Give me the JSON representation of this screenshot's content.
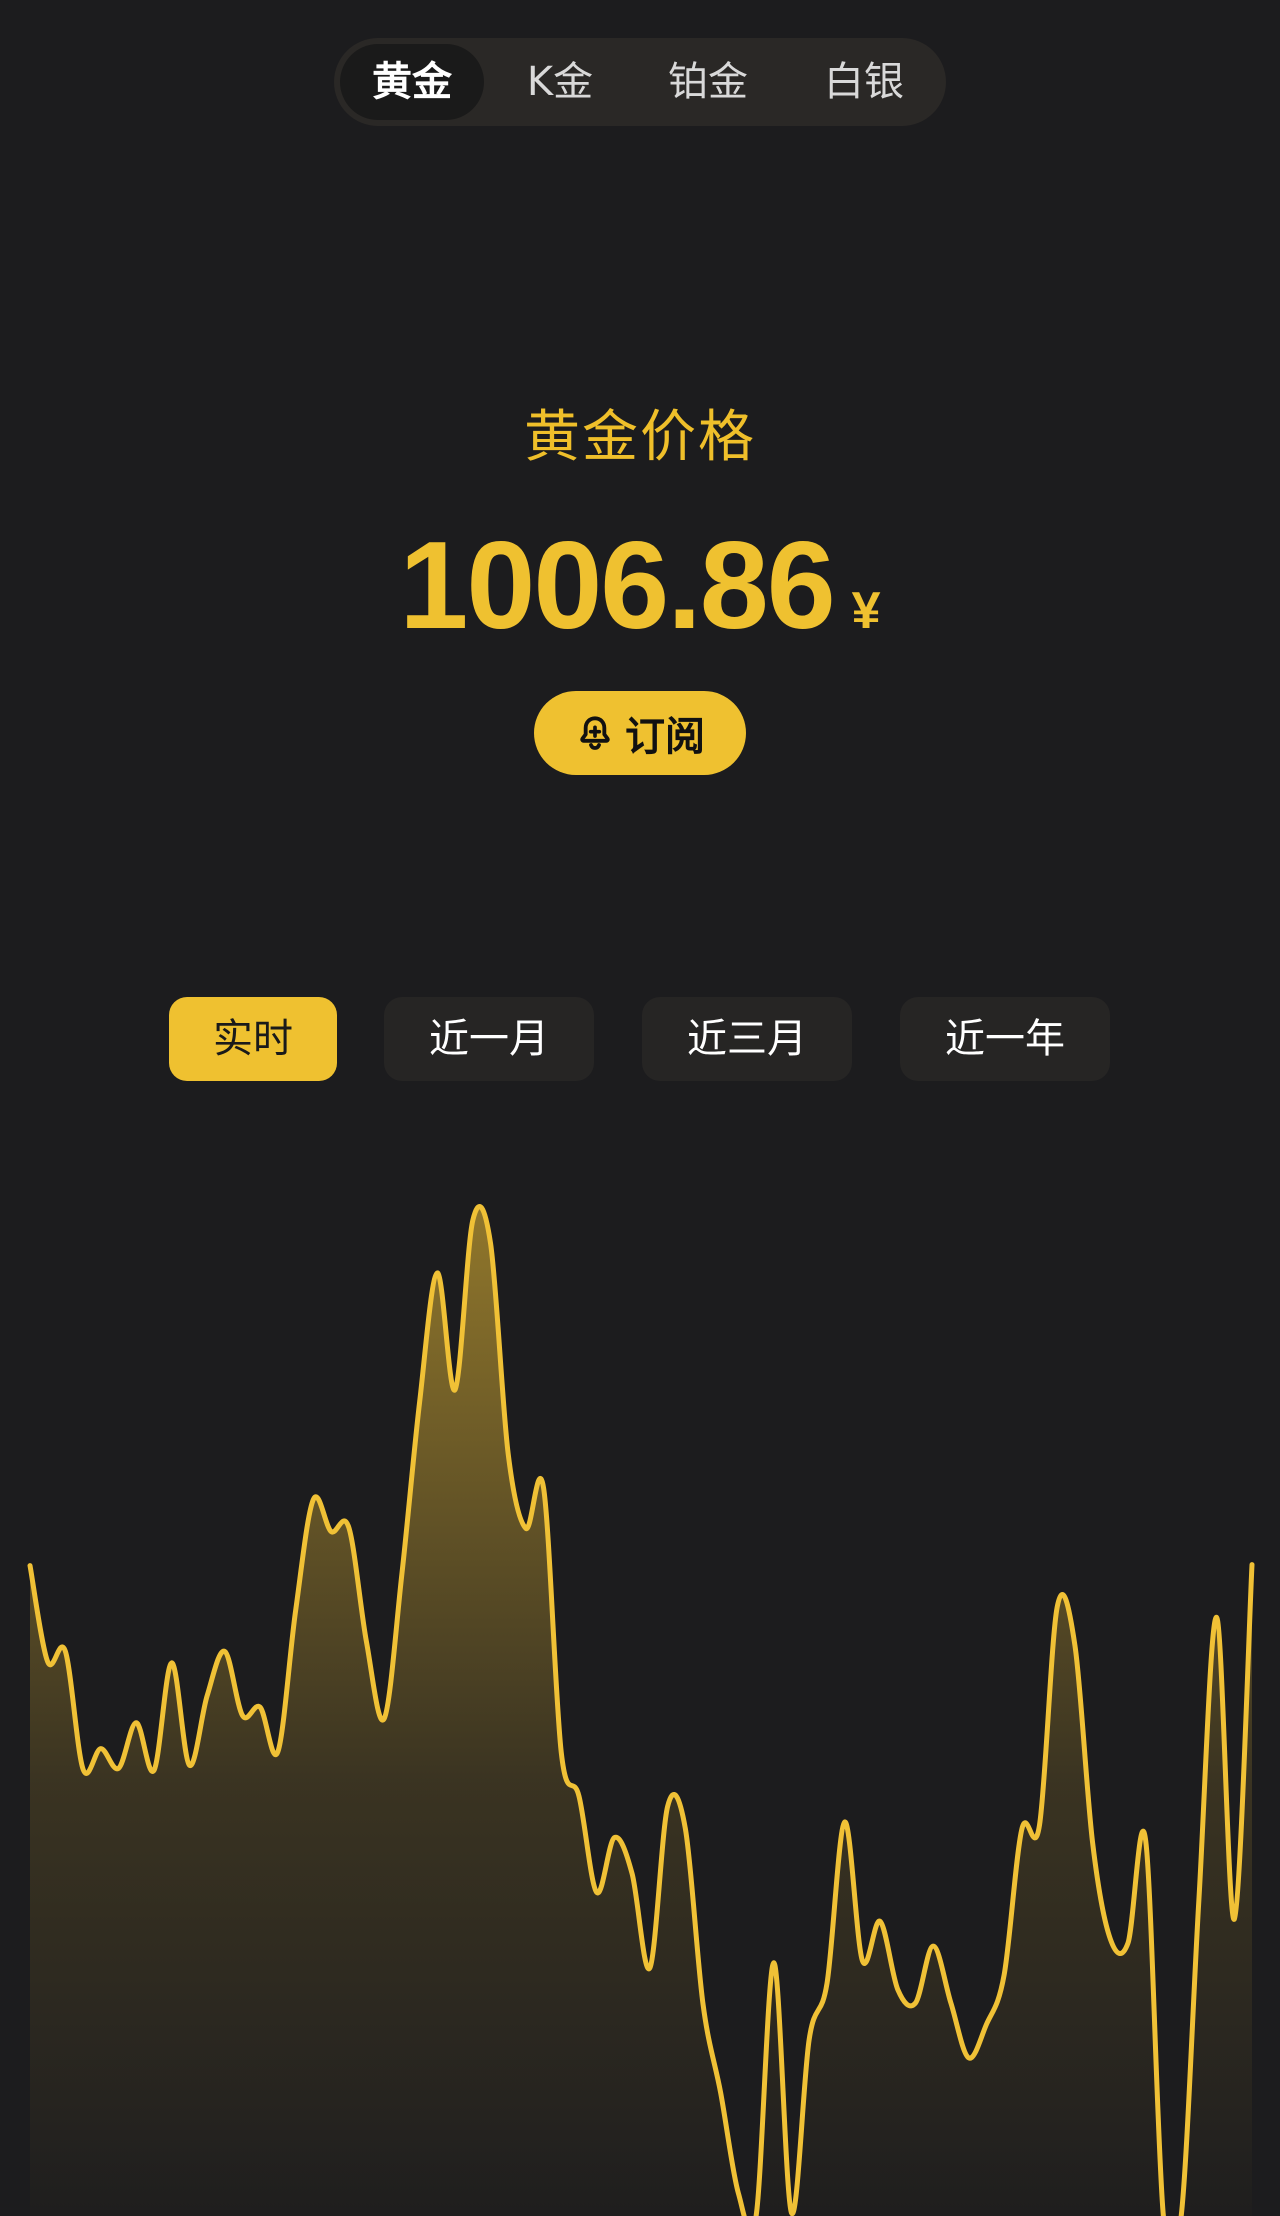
{
  "metal_tabs": [
    {
      "label": "黄金",
      "active": true
    },
    {
      "label": "K金",
      "active": false
    },
    {
      "label": "铂金",
      "active": false
    },
    {
      "label": "白银",
      "active": false
    }
  ],
  "header": {
    "title": "黄金价格",
    "price": "1006.86",
    "currency": "¥",
    "subscribe_label": "订阅",
    "subscribe_icon": "bell-plus-icon"
  },
  "range_tabs": [
    {
      "label": "实时",
      "active": true
    },
    {
      "label": "近一月",
      "active": false
    },
    {
      "label": "近三月",
      "active": false
    },
    {
      "label": "近一年",
      "active": false
    }
  ],
  "colors": {
    "background": "#1c1c1e",
    "accent": "#efc130",
    "line": "#f0c136"
  },
  "chart_data": {
    "type": "area",
    "title": "",
    "xlabel": "",
    "ylabel": "",
    "grid": false,
    "legend": "none",
    "ylim": [
      0,
      100
    ],
    "series": [
      {
        "values": [
          62.9,
          53.6,
          54.6,
          43.2,
          45.2,
          43.3,
          47.7,
          43.1,
          53.5,
          43.6,
          50.3,
          54.6,
          48.4,
          49.2,
          44.9,
          58.6,
          69.3,
          66.2,
          66.6,
          55.5,
          48.1,
          62.1,
          78.7,
          91.2,
          79.9,
          96.3,
          94.1,
          73.7,
          66.5,
          70.4,
          44.8,
          40.6,
          31.3,
          36.6,
          33.1,
          24.0,
          39.6,
          37.5,
          20.5,
          11.9,
          2.2,
          0.0,
          24.5,
          0.3,
          17.1,
          22.5,
          38.1,
          24.7,
          28.5,
          21.9,
          20.6,
          26.1,
          20.6,
          15.3,
          18.5,
          23.3,
          37.4,
          37.8,
          58.9,
          55.2,
          36.1,
          26.8,
          26.4,
          36.3,
          0.0,
          0.0,
          30.6,
          57.9,
          28.7,
          63.0
        ]
      }
    ]
  }
}
